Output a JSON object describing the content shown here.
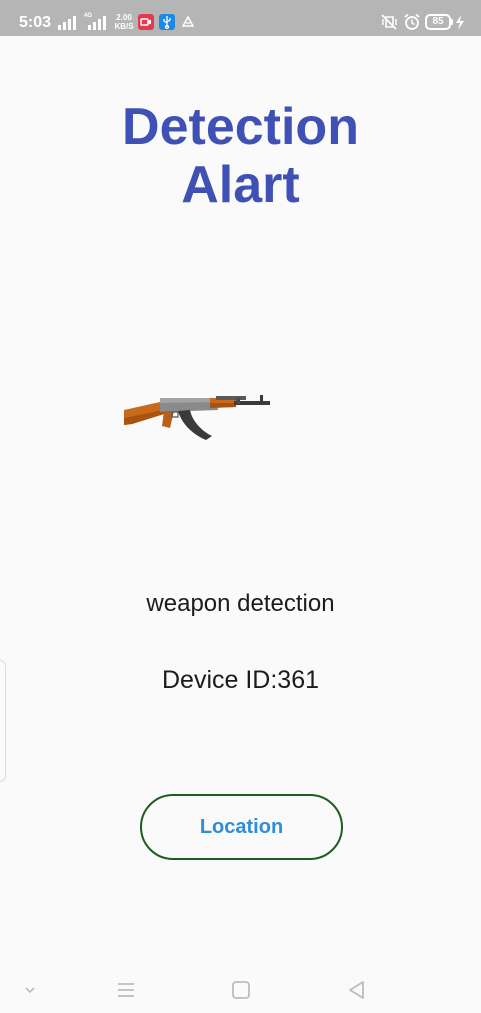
{
  "status_bar": {
    "time": "5:03",
    "net_speed_value": "2.00",
    "net_speed_unit": "KB/S",
    "network_type": "4G",
    "battery_level": "85"
  },
  "screen": {
    "title_line1": "Detection",
    "title_line2": "Alart",
    "title_color": "#3f51b5",
    "detection_type": "weapon detection",
    "device_id": "Device ID:361",
    "location_button_label": "Location",
    "button_text_color": "#2e8fd8",
    "button_border_color": "#1b5e20"
  },
  "icons": {
    "weapon_image": "rifle-icon",
    "nav_down": "chevron-down-icon",
    "nav_menu": "menu-icon",
    "nav_home": "home-square-icon",
    "nav_back": "back-triangle-icon"
  }
}
